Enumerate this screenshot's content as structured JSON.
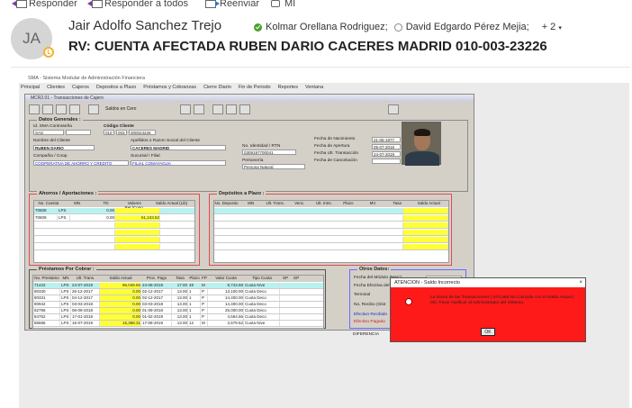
{
  "toolbar": {
    "reply": "Responder",
    "reply_all": "Responder a todos",
    "forward": "Reenviar",
    "im": "MI"
  },
  "message": {
    "avatar_initials": "JA",
    "sender": "Jair Adolfo Sanchez Trejo",
    "recipients": [
      "Kolmar Orellana Rodriguez;",
      "David Edgardo Pérez Mejia;"
    ],
    "more_recipients": "+ 2",
    "subject": "RV: CUENTA AFECTADA RUBEN DARIO CACERES MADRID 010-003-23226"
  },
  "app": {
    "title": "SMA - Sistema Modular de Administración Financiera",
    "menu": [
      "Principal",
      "Clientes",
      "Cajeros",
      "Depositos a Plazo",
      "Préstamos y Cobranzas",
      "Cierre Diario",
      "Fin de Periodo",
      "Reportes",
      "Ventana"
    ],
    "window_title": "MCR2.01 - Transacciones de Cajero",
    "search_label": "Saldos en Cero",
    "general": {
      "title": "Datos Generales :",
      "id_label": "Id. SMA  Contraseña",
      "id_value": "SAS",
      "code_label": "Código Cliente",
      "code_prefix": "010",
      "code_mid": "003",
      "code_value": "000023226",
      "name_label": "Nombre del Cliente",
      "name_value": "RUBEN DARIO",
      "surname_label": "Apellidos o Razon Social del Cliente",
      "surname_value": "CACERES MADRID",
      "company_label": "Compañia / Coop.",
      "company_value": "COOPERATIVA DE AHORRO Y CREDITO",
      "branch_label": "Sucursal / Filial",
      "branch_value": "FILIAL COMAYAGUA",
      "id_num_label": "No. Identidad / RTN",
      "id_num_value": "0309197700041",
      "person_label": "Personería",
      "person_value": "Persona Natural",
      "birth_label": "Fecha de Nacimiento",
      "birth_value": "21-05-1977",
      "open_label": "Fecha de Apertura",
      "open_value": "05-07-2016",
      "last_tx_label": "Fecha Ult. Transacción",
      "last_tx_value": "24-07-2019",
      "cancel_label": "Fecha de Cancelación",
      "cancel_value": ""
    },
    "savings": {
      "title": "Ahorros / Aportaciones :",
      "headers": [
        "No. Cuenta",
        "MN",
        "TD",
        "Valores Ret./Cong.",
        "Saldo Actual (Lib)"
      ],
      "rows": [
        {
          "acct": "70608",
          "mn": "LPS",
          "val": "0.00",
          "bal": ""
        },
        {
          "acct": "70609",
          "mn": "LPS",
          "val": "0.00",
          "bal": "51,243.52"
        }
      ]
    },
    "deposits": {
      "title": "Depósitos a Plazo :",
      "headers": [
        "No. Deposito",
        "MN",
        "Ult. Trans.",
        "Venc.",
        "Ult. Intrs.",
        "Plazo",
        "MV",
        "Tasa",
        "Saldo Actual"
      ]
    },
    "loans": {
      "title": "Préstamos Por Cobrar :",
      "headers": [
        "No. Prestamo",
        "MN",
        "Ult. Trans.",
        "Saldo Actual",
        "Proc. Pago",
        "Tasa",
        "Plazo",
        "FP",
        "Valor Cuota",
        "Tipo Cuota",
        "SP",
        "GP"
      ],
      "rows": [
        {
          "num": "71422",
          "mn": "LPS",
          "last": "24-07-2019",
          "bal": "96,049.65",
          "pay": "24-08-2019",
          "rate": "17.00",
          "term": "48",
          "fp": "M",
          "fee": "8,743.68",
          "type": "Cuota Nive"
        },
        {
          "num": "80330",
          "mn": "LPS",
          "last": "26-12-2017",
          "bal": "0.00",
          "pay": "02-12-2017",
          "rate": "13.00",
          "term": "1",
          "fp": "P",
          "fee": "13,100.00",
          "type": "Cuota Deco"
        },
        {
          "num": "80331",
          "mn": "LPS",
          "last": "04-12-2017",
          "bal": "0.00",
          "pay": "02-12-2017",
          "rate": "13.00",
          "term": "1",
          "fp": "P",
          "fee": "14,400.00",
          "type": "Cuota Deco"
        },
        {
          "num": "80942",
          "mn": "LPS",
          "last": "03-03-2018",
          "bal": "0.00",
          "pay": "03-03-2018",
          "rate": "13.00",
          "term": "1",
          "fp": "P",
          "fee": "14,400.00",
          "type": "Cuota Deco"
        },
        {
          "num": "82796",
          "mn": "LPS",
          "last": "06-09-2018",
          "bal": "0.00",
          "pay": "01-09-2018",
          "rate": "13.00",
          "term": "1",
          "fp": "P",
          "fee": "25,000.00",
          "type": "Cuota Deco"
        },
        {
          "num": "84752",
          "mn": "LPS",
          "last": "17-01-2019",
          "bal": "0.00",
          "pay": "01-02-2019",
          "rate": "13.00",
          "term": "1",
          "fp": "P",
          "fee": "4,564.56",
          "type": "Cuota Deco"
        },
        {
          "num": "86685",
          "mn": "LPS",
          "last": "16-07-2019",
          "bal": "15,388.31",
          "pay": "17-08-2019",
          "rate": "13.00",
          "term": "12",
          "fp": "M",
          "fee": "2,679.52",
          "type": "Cuota Nive"
        }
      ]
    },
    "other": {
      "title": "Otros Datos:",
      "module_date_label": "Fecha del Módulo (MAC)",
      "module_date_value": "24-07-2019",
      "cashier_date_label": "Fecha Efectiva del Cajero",
      "cashier_date_value": "24-07-2019",
      "terminal_label": "Terminal",
      "terminal_value": "TB17",
      "receipt_label": "No. Recibo (Glot",
      "received_label": "Efectivo Recibido",
      "paid_label": "Efectivo Pagado",
      "diff_label": "DIFERENCIA"
    },
    "dialog": {
      "title": "ATENCION - Saldo Incorrecto",
      "message": "La Suma de las Transacciones (          570,465 No Coincide con el Saldo Actual (          00). Favor Notificar al Administrador del Sistema.",
      "ok": "OK"
    },
    "colors": {
      "dialog_bg": "#ff1a1a",
      "highlight_yellow": "#ffff37",
      "row_cyan": "#b8f2f0"
    }
  }
}
